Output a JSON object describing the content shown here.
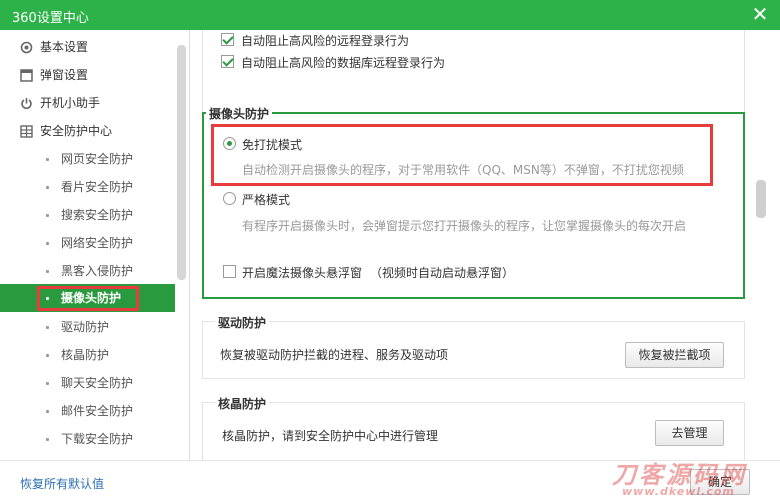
{
  "window": {
    "title": "360设置中心",
    "close_icon": "close-icon"
  },
  "sidebar": {
    "items": [
      {
        "label": "基本设置",
        "icon": "gear-icon"
      },
      {
        "label": "弹窗设置",
        "icon": "window-icon"
      },
      {
        "label": "开机小助手",
        "icon": "power-icon"
      },
      {
        "label": "安全防护中心",
        "icon": "grid-icon"
      }
    ],
    "sub_items": [
      {
        "label": "网页安全防护"
      },
      {
        "label": "看片安全防护"
      },
      {
        "label": "搜索安全防护"
      },
      {
        "label": "网络安全防护"
      },
      {
        "label": "黑客入侵防护"
      },
      {
        "label": "摄像头防护",
        "active": true
      },
      {
        "label": "驱动防护"
      },
      {
        "label": "核晶防护"
      },
      {
        "label": "聊天安全防护"
      },
      {
        "label": "邮件安全防护"
      },
      {
        "label": "下载安全防护"
      }
    ]
  },
  "main": {
    "remote_login": {
      "partial_label": "自动阻止高风险的远程登录行为",
      "db_label": "自动阻止高风险的数据库远程登录行为",
      "db_checked": true
    },
    "camera": {
      "title": "摄像头防护",
      "mode_free": "免打扰模式",
      "mode_free_desc": "自动检测开启摄像头的程序，对于常用软件（QQ、MSN等）不弹窗，不打扰您视频",
      "mode_strict": "严格模式",
      "mode_strict_desc": "有程序开启摄像头时，会弹窗提示您打开摄像头的程序，让您掌握摄像头的每次开启",
      "selected_mode": "免打扰模式",
      "magic_label": "开启魔法摄像头悬浮窗",
      "magic_note": "（视频时自动启动悬浮窗）",
      "magic_checked": false
    },
    "driver": {
      "title": "驱动防护",
      "desc": "恢复被驱动防护拦截的进程、服务及驱动项",
      "button": "恢复被拦截项"
    },
    "core": {
      "title": "核晶防护",
      "desc": "核晶防护，请到安全防护中心中进行管理",
      "button": "去管理"
    }
  },
  "footer": {
    "restore_link": "恢复所有默认值",
    "ok_button": "确定"
  },
  "watermark": {
    "text": "刀客源码网",
    "url": "www.dkewl.com"
  },
  "colors": {
    "brand_green": "#2db24a",
    "active_green": "#2a9a3e",
    "highlight_red": "#e63c3c",
    "link_blue": "#2a6fb5"
  }
}
